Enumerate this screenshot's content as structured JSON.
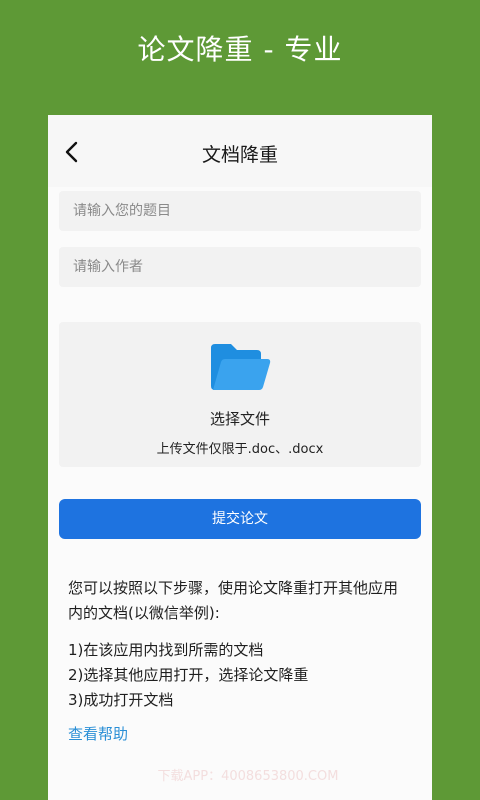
{
  "banner": {
    "title": "论文降重 - 专业"
  },
  "nav": {
    "title": "文档降重",
    "back_icon": "chevron-left-icon"
  },
  "form": {
    "title_placeholder": "请输入您的题目",
    "author_placeholder": "请输入作者"
  },
  "upload": {
    "icon": "folder-open-icon",
    "title": "选择文件",
    "hint": "上传文件仅限于.doc、.docx"
  },
  "submit": {
    "label": "提交论文"
  },
  "instructions": {
    "intro": "您可以按照以下步骤，使用论文降重打开其他应用内的文档(以微信举例):",
    "steps": [
      "1)在该应用内找到所需的文档",
      "2)选择其他应用打开，选择论文降重",
      "3)成功打开文档"
    ]
  },
  "help": {
    "label": "查看帮助"
  },
  "watermark": {
    "text": "下载APP：4008653800.COM"
  },
  "colors": {
    "brand_green": "#5e9936",
    "primary_blue": "#1e73e0",
    "link_blue": "#2a8fd6",
    "folder_blue": "#1f8ee0"
  }
}
